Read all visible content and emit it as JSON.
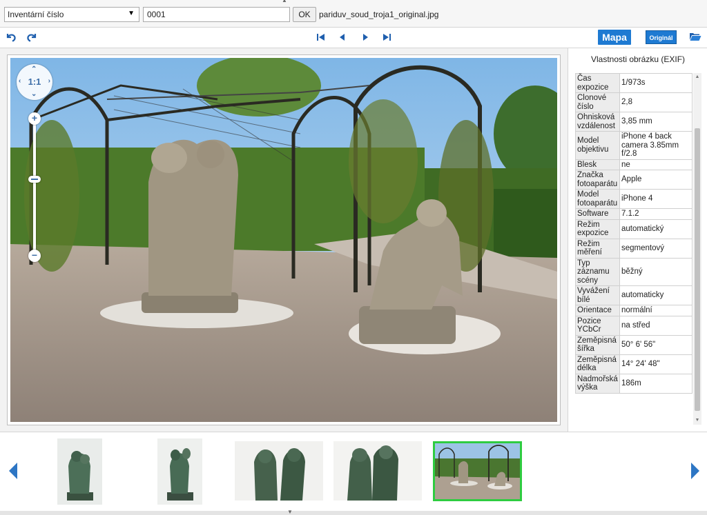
{
  "search": {
    "field_selected": "Inventární číslo",
    "number_value": "0001",
    "ok_label": "OK",
    "filename": "pariduv_soud_troja1_original.jpg"
  },
  "toolbar": {
    "undo_icon": "undo-icon",
    "redo_icon": "redo-icon",
    "first_icon": "first-icon",
    "prev_icon": "prev-icon",
    "next_icon": "next-icon",
    "last_icon": "last-icon",
    "map_label": "Mapa",
    "original_label": "Originál",
    "folder_icon": "folder-open-icon"
  },
  "viewer": {
    "zoom_reset_label": "1:1",
    "zoom_in_label": "+",
    "zoom_out_label": "−"
  },
  "exif": {
    "title": "Vlastnosti obrázku (EXIF)",
    "rows": [
      {
        "key": "Čas expozice",
        "value": "1/973s"
      },
      {
        "key": "Clonové číslo",
        "value": "2,8"
      },
      {
        "key": "Ohnisková vzdálenost",
        "value": "3,85 mm"
      },
      {
        "key": "Model objektivu",
        "value": "iPhone 4 back camera 3.85mm f/2.8"
      },
      {
        "key": "Blesk",
        "value": "ne"
      },
      {
        "key": "Značka fotoaparátu",
        "value": "Apple"
      },
      {
        "key": "Model fotoaparátu",
        "value": "iPhone 4"
      },
      {
        "key": "Software",
        "value": "7.1.2"
      },
      {
        "key": "Režim expozice",
        "value": "automatický"
      },
      {
        "key": "Režim měření",
        "value": "segmentový"
      },
      {
        "key": "Typ záznamu scény",
        "value": "běžný"
      },
      {
        "key": "Vyvážení bílé",
        "value": "automaticky"
      },
      {
        "key": "Orientace",
        "value": "normální"
      },
      {
        "key": "Pozice YCbCr",
        "value": "na střed"
      },
      {
        "key": "Zeměpisná šířka",
        "value": "50° 6' 56\""
      },
      {
        "key": "Zeměpisná délka",
        "value": "14° 24' 48\""
      },
      {
        "key": "Nadmořská výška",
        "value": "186m"
      }
    ]
  },
  "thumbnails": {
    "items": [
      {
        "name": "statue-front",
        "selected": false
      },
      {
        "name": "statue-side",
        "selected": false
      },
      {
        "name": "statue-group-wide",
        "selected": false
      },
      {
        "name": "statue-group-back",
        "selected": false
      },
      {
        "name": "garden-photo",
        "selected": true
      }
    ]
  },
  "colors": {
    "accent_blue": "#1e7ad2",
    "selected_thumb_border": "#2ecc40",
    "nav_blue": "#1f5fae"
  }
}
